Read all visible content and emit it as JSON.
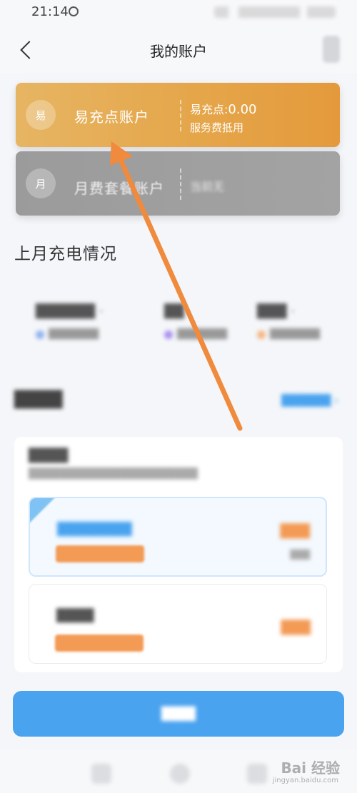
{
  "status_bar": {
    "time": "21:14",
    "alarm_icon": "alarm-icon"
  },
  "nav": {
    "title": "我的账户",
    "back_icon": "chevron-left-icon"
  },
  "accounts": [
    {
      "badge": "易",
      "title": "易充点账户",
      "points_label": "易充点:",
      "points_value": "0.00",
      "note": "服务费抵用"
    },
    {
      "badge": "月",
      "title": "月费套餐账户",
      "note": "当前无"
    }
  ],
  "last_month": {
    "title": "上月充电情况"
  },
  "colors": {
    "accent_blue": "#4aa3ef",
    "gold": "#e5a64a",
    "grey_card": "#9e9e9e",
    "arrow_orange": "#f08a3c",
    "price_orange": "#f39a55"
  },
  "watermark": {
    "text": "Bai 经验",
    "sub": "jingyan.baidu.com"
  }
}
